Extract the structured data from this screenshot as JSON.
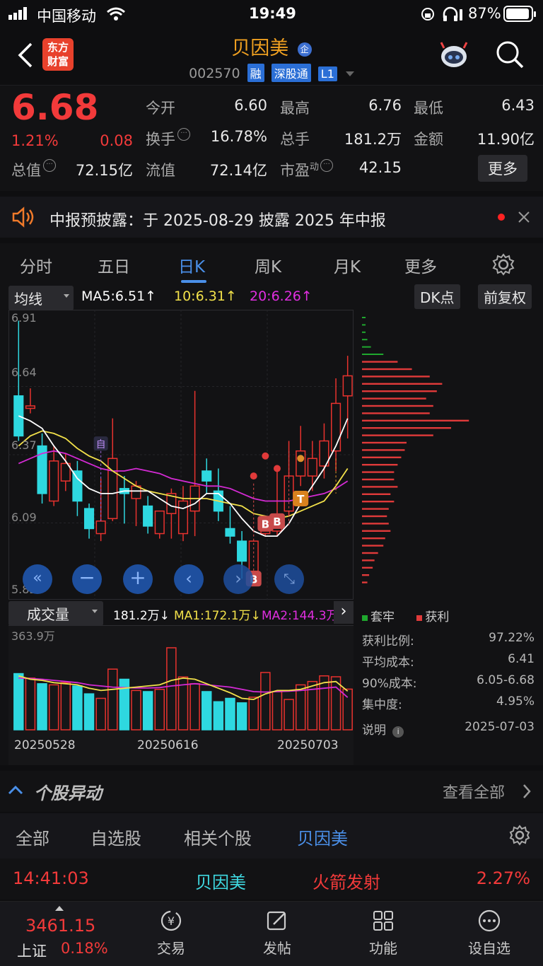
{
  "status": {
    "carrier": "中国移动",
    "time": "19:49",
    "battery": "87%"
  },
  "header": {
    "logo_line1": "东方",
    "logo_line2": "财富",
    "stock_name": "贝因美",
    "badge": "企",
    "code": "002570",
    "tags": [
      "融",
      "深股通",
      "L1"
    ]
  },
  "quote": {
    "price": "6.68",
    "change_pct": "1.21%",
    "change": "0.08",
    "fields": [
      {
        "label": "今开",
        "value": "6.60",
        "color": "white"
      },
      {
        "label": "最高",
        "value": "6.76",
        "color": "red"
      },
      {
        "label": "最低",
        "value": "6.43",
        "color": "green"
      },
      {
        "label": "换手",
        "value": "16.78%",
        "color": "white"
      },
      {
        "label": "总手",
        "value": "181.2万",
        "color": "white"
      },
      {
        "label": "金额",
        "value": "11.90亿",
        "color": "white"
      },
      {
        "label": "总值",
        "value": "72.15亿",
        "color": "white"
      },
      {
        "label": "流值",
        "value": "72.14亿",
        "color": "white"
      },
      {
        "label": "市盈",
        "value": "42.15",
        "color": "white"
      }
    ],
    "pe_sup": "动",
    "more_label": "更多"
  },
  "notice": {
    "text": "中报预披露：于 2025-08-29 披露 2025 年中报"
  },
  "chart_tabs": [
    "分时",
    "五日",
    "日K",
    "周K",
    "月K",
    "更多"
  ],
  "active_tab": "日K",
  "ma_legend": {
    "selector": "均线",
    "ma5": "MA5:6.51↑",
    "ma10": "10:6.31↑",
    "ma20": "20:6.26↑",
    "dk_btn": "DK点",
    "fq_btn": "前复权"
  },
  "chart_data": [
    {
      "type": "candlestick",
      "y_ticks": [
        "6.91",
        "6.64",
        "6.37",
        "6.09",
        "5.82"
      ],
      "ylim": [
        5.82,
        6.91
      ],
      "candles": [
        {
          "o": 6.6,
          "c": 6.44,
          "h": 6.9,
          "l": 6.42
        },
        {
          "o": 6.55,
          "c": 6.56,
          "h": 6.63,
          "l": 6.53
        },
        {
          "o": 6.4,
          "c": 6.21,
          "h": 6.45,
          "l": 6.17
        },
        {
          "o": 6.18,
          "c": 6.34,
          "h": 6.4,
          "l": 6.16
        },
        {
          "o": 6.26,
          "c": 6.33,
          "h": 6.37,
          "l": 6.22
        },
        {
          "o": 6.3,
          "c": 6.18,
          "h": 6.34,
          "l": 6.12
        },
        {
          "o": 6.15,
          "c": 6.07,
          "h": 6.17,
          "l": 6.03
        },
        {
          "o": 6.05,
          "c": 6.1,
          "h": 6.27,
          "l": 6.02
        },
        {
          "o": 6.11,
          "c": 6.35,
          "h": 6.51,
          "l": 6.1
        },
        {
          "o": 6.23,
          "c": 6.21,
          "h": 6.28,
          "l": 6.09
        },
        {
          "o": 6.19,
          "c": 6.24,
          "h": 6.26,
          "l": 6.08
        },
        {
          "o": 6.16,
          "c": 6.08,
          "h": 6.2,
          "l": 6.05
        },
        {
          "o": 6.05,
          "c": 6.14,
          "h": 6.14,
          "l": 6.03
        },
        {
          "o": 6.13,
          "c": 6.21,
          "h": 6.23,
          "l": 6.03
        },
        {
          "o": 6.05,
          "c": 6.18,
          "h": 6.24,
          "l": 6.02
        },
        {
          "o": 6.14,
          "c": 6.24,
          "h": 6.62,
          "l": 6.04
        },
        {
          "o": 6.3,
          "c": 6.26,
          "h": 6.35,
          "l": 6.21
        },
        {
          "o": 6.22,
          "c": 6.14,
          "h": 6.31,
          "l": 6.1
        },
        {
          "o": 6.07,
          "c": 6.04,
          "h": 6.16,
          "l": 6.01
        },
        {
          "o": 6.02,
          "c": 5.94,
          "h": 6.06,
          "l": 5.87
        },
        {
          "o": 5.9,
          "c": 6.02,
          "h": 6.02,
          "l": 5.84
        },
        {
          "o": 6.05,
          "c": 6.06,
          "h": 6.08,
          "l": 6.04
        },
        {
          "o": 6.06,
          "c": 6.1,
          "h": 6.31,
          "l": 6.04
        },
        {
          "o": 6.14,
          "c": 6.28,
          "h": 6.42,
          "l": 6.12
        },
        {
          "o": 6.28,
          "c": 6.38,
          "h": 6.48,
          "l": 6.24
        },
        {
          "o": 6.28,
          "c": 6.35,
          "h": 6.42,
          "l": 6.22
        },
        {
          "o": 6.32,
          "c": 6.42,
          "h": 6.49,
          "l": 6.27
        },
        {
          "o": 6.38,
          "c": 6.57,
          "h": 6.67,
          "l": 6.3
        },
        {
          "o": 6.6,
          "c": 6.68,
          "h": 6.76,
          "l": 6.43
        }
      ],
      "ma5": [
        6.52,
        6.5,
        6.47,
        6.4,
        6.34,
        6.27,
        6.23,
        6.21,
        6.21,
        6.22,
        6.22,
        6.22,
        6.19,
        6.16,
        6.15,
        6.17,
        6.21,
        6.21,
        6.17,
        6.11,
        6.06,
        6.04,
        6.04,
        6.09,
        6.17,
        6.24,
        6.31,
        6.4,
        6.51
      ],
      "ma10": [
        6.4,
        6.44,
        6.46,
        6.45,
        6.43,
        6.39,
        6.36,
        6.34,
        6.3,
        6.27,
        6.24,
        6.22,
        6.21,
        6.2,
        6.19,
        6.19,
        6.19,
        6.18,
        6.17,
        6.16,
        6.13,
        6.12,
        6.11,
        6.12,
        6.14,
        6.16,
        6.18,
        6.24,
        6.31
      ],
      "ma20": [
        6.33,
        6.35,
        6.37,
        6.38,
        6.37,
        6.35,
        6.33,
        6.31,
        6.3,
        6.3,
        6.31,
        6.3,
        6.29,
        6.27,
        6.26,
        6.25,
        6.24,
        6.24,
        6.23,
        6.21,
        6.19,
        6.18,
        6.18,
        6.18,
        6.19,
        6.2,
        6.21,
        6.23,
        6.26
      ]
    },
    {
      "type": "bar",
      "name": "成交量",
      "y_top_label": "363.9万",
      "x_labels": [
        "20250528",
        "20250616",
        "20250703"
      ],
      "values": [
        250,
        230,
        205,
        200,
        210,
        195,
        160,
        140,
        270,
        225,
        175,
        170,
        180,
        365,
        235,
        205,
        170,
        125,
        140,
        120,
        145,
        255,
        170,
        135,
        200,
        215,
        240,
        236,
        181
      ],
      "ma1": [
        240,
        225,
        220,
        210,
        205,
        200,
        185,
        175,
        180,
        185,
        190,
        195,
        200,
        220,
        230,
        225,
        205,
        185,
        165,
        140,
        135,
        160,
        175,
        175,
        180,
        195,
        210,
        215,
        172
      ],
      "ma2": [
        230,
        228,
        225,
        220,
        215,
        210,
        200,
        195,
        190,
        188,
        186,
        186,
        188,
        195,
        200,
        205,
        200,
        195,
        190,
        180,
        170,
        168,
        170,
        172,
        175,
        180,
        185,
        190,
        144
      ]
    },
    {
      "type": "bar",
      "name": "chip-distribution",
      "series": [
        {
          "name": "套牢",
          "values": [
            0.02,
            0.02,
            0.02,
            0.03,
            0.05,
            0.12
          ]
        },
        {
          "name": "获利",
          "values": [
            0.2,
            0.28,
            0.38,
            0.45,
            0.42,
            0.36,
            0.4,
            0.38,
            0.6,
            0.5,
            0.4,
            0.25,
            0.24,
            0.22,
            0.2,
            0.18,
            0.18,
            0.2,
            0.16,
            0.18,
            0.15,
            0.14,
            0.15,
            0.16,
            0.13,
            0.12,
            0.09,
            0.07,
            0.06,
            0.04,
            0.03
          ]
        }
      ]
    }
  ],
  "volume_legend": {
    "selector": "成交量",
    "vol": "181.2万↓",
    "ma1": "MA1:172.1万↓",
    "ma2": "MA2:144.3万"
  },
  "chip": {
    "legend_trapped": "套牢",
    "legend_profit": "获利",
    "stats": [
      {
        "label": "获利比例:",
        "value": "97.22%"
      },
      {
        "label": "平均成本:",
        "value": "6.41"
      },
      {
        "label": "90%成本:",
        "value": "6.05-6.68"
      },
      {
        "label": "集中度:",
        "value": "4.95%"
      }
    ],
    "note_label": "说明",
    "date": "2025-07-03"
  },
  "markers": {
    "self": "自",
    "buy": "B",
    "take": "T"
  },
  "movement": {
    "title": "个股异动",
    "view_all": "查看全部",
    "tabs": [
      "全部",
      "自选股",
      "相关个股",
      "贝因美"
    ],
    "active_tab": "贝因美",
    "row": {
      "time": "14:41:03",
      "name": "贝因美",
      "event": "火箭发射",
      "pct": "2.27%"
    }
  },
  "bottom_nav": {
    "index_value": "3461.15",
    "index_name": "上证",
    "index_pct": "0.18%",
    "items": [
      "交易",
      "发帖",
      "功能",
      "设自选"
    ]
  }
}
